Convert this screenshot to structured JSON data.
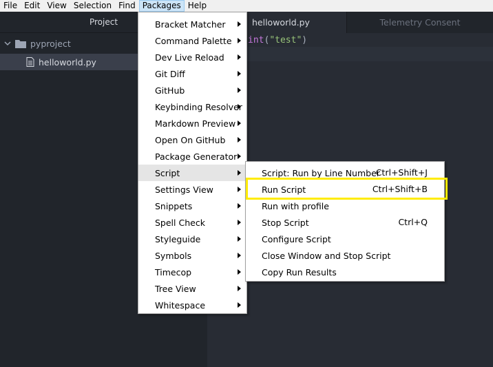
{
  "menubar": {
    "items": [
      "File",
      "Edit",
      "View",
      "Selection",
      "Find",
      "Packages",
      "Help"
    ],
    "active_index": 5
  },
  "tree": {
    "title": "Project",
    "folder": "pyproject",
    "file": "helloworld.py"
  },
  "tabs": [
    {
      "label": "helloworld.py"
    },
    {
      "label": "Telemetry Consent"
    }
  ],
  "editor": {
    "code_fn": "int",
    "code_open": "(",
    "code_str": "\"test\"",
    "code_close": ")"
  },
  "packages_menu": {
    "items": [
      "Bracket Matcher",
      "Command Palette",
      "Dev Live Reload",
      "Git Diff",
      "GitHub",
      "Keybinding Resolver",
      "Markdown Preview",
      "Open On GitHub",
      "Package Generator",
      "Script",
      "Settings View",
      "Snippets",
      "Spell Check",
      "Styleguide",
      "Symbols",
      "Timecop",
      "Tree View",
      "Whitespace"
    ],
    "highlighted": "Script"
  },
  "script_menu": {
    "items": [
      {
        "label": "Script: Run by Line Number",
        "shortcut": "Ctrl+Shift+J"
      },
      {
        "label": "Run Script",
        "shortcut": "Ctrl+Shift+B"
      },
      {
        "label": "Run with profile",
        "shortcut": ""
      },
      {
        "label": "Stop Script",
        "shortcut": "Ctrl+Q"
      },
      {
        "label": "Configure Script",
        "shortcut": ""
      },
      {
        "label": "Close Window and Stop Script",
        "shortcut": ""
      },
      {
        "label": "Copy Run Results",
        "shortcut": ""
      }
    ],
    "highlighted": "Run Script"
  },
  "colors": {
    "highlight_outline": "#ffec00",
    "menu_hover": "#e5e5e5"
  }
}
